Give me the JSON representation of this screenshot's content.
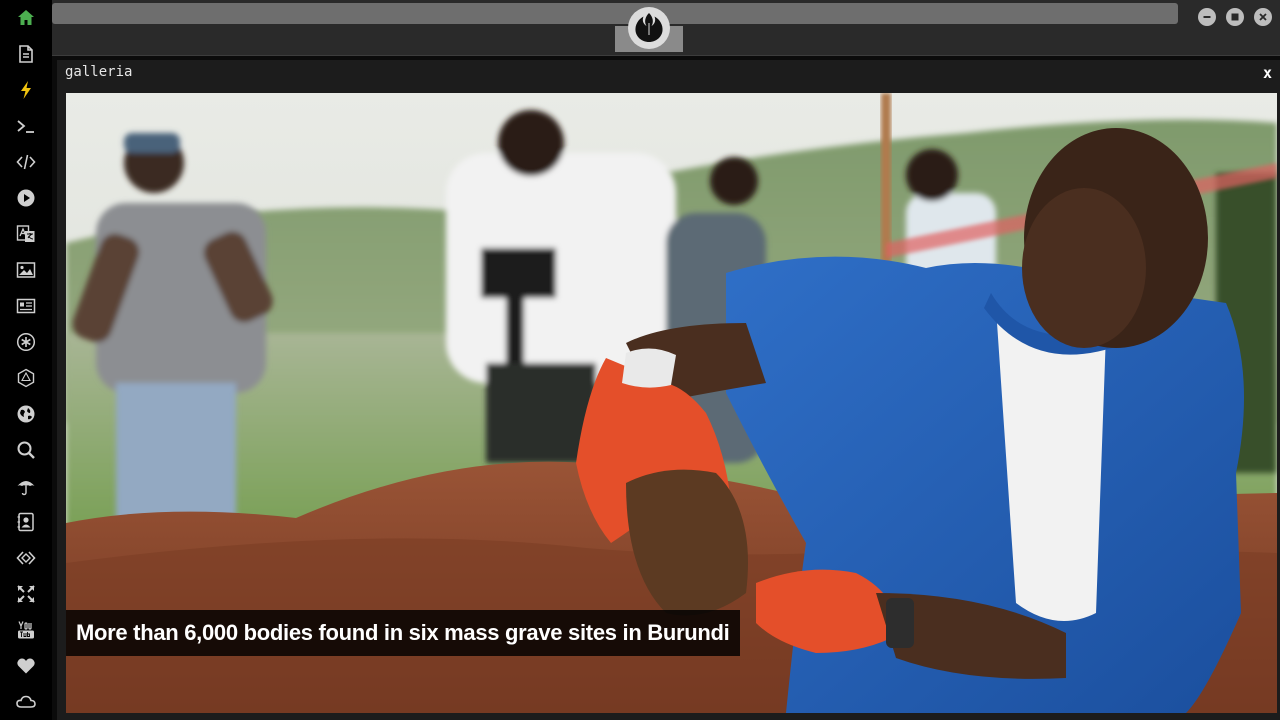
{
  "window": {
    "emblem_icon": "rebel-alliance-emblem-icon"
  },
  "sidebar": {
    "items": [
      {
        "name": "home",
        "icon": "home-icon",
        "color": "#4caf50"
      },
      {
        "name": "document",
        "icon": "document-icon",
        "color": "#cfcfcf"
      },
      {
        "name": "flash",
        "icon": "lightning-icon",
        "color": "#f1c40f"
      },
      {
        "name": "terminal",
        "icon": "terminal-icon",
        "color": "#cfcfcf"
      },
      {
        "name": "code",
        "icon": "code-icon",
        "color": "#cfcfcf"
      },
      {
        "name": "play",
        "icon": "play-icon",
        "color": "#cfcfcf"
      },
      {
        "name": "translate",
        "icon": "translate-icon",
        "color": "#cfcfcf"
      },
      {
        "name": "image",
        "icon": "image-icon",
        "color": "#cfcfcf"
      },
      {
        "name": "news",
        "icon": "newspaper-icon",
        "color": "#cfcfcf"
      },
      {
        "name": "asterisk",
        "icon": "asterisk-icon",
        "color": "#cfcfcf"
      },
      {
        "name": "hexagon",
        "icon": "hexagon-icon",
        "color": "#cfcfcf"
      },
      {
        "name": "globe",
        "icon": "globe-icon",
        "color": "#cfcfcf"
      },
      {
        "name": "search",
        "icon": "search-icon",
        "color": "#cfcfcf"
      },
      {
        "name": "umbrella",
        "icon": "umbrella-icon",
        "color": "#cfcfcf"
      },
      {
        "name": "contacts",
        "icon": "contact-card-icon",
        "color": "#cfcfcf"
      },
      {
        "name": "dev",
        "icon": "dev-code-icon",
        "color": "#cfcfcf"
      },
      {
        "name": "fullscreen",
        "icon": "expand-icon",
        "color": "#cfcfcf"
      },
      {
        "name": "youtube",
        "icon": "youtube-icon",
        "color": "#cfcfcf"
      },
      {
        "name": "favorites",
        "icon": "heart-icon",
        "color": "#cfcfcf"
      },
      {
        "name": "cloud",
        "icon": "cloud-icon",
        "color": "#cfcfcf"
      }
    ]
  },
  "controls": {
    "minimize_icon": "minimize-icon",
    "maximize_icon": "maximize-icon",
    "close_icon": "close-icon"
  },
  "gallery": {
    "title": "galleria",
    "close_label": "x",
    "caption": "More than 6,000 bodies found in six mass grave sites in Burundi"
  }
}
